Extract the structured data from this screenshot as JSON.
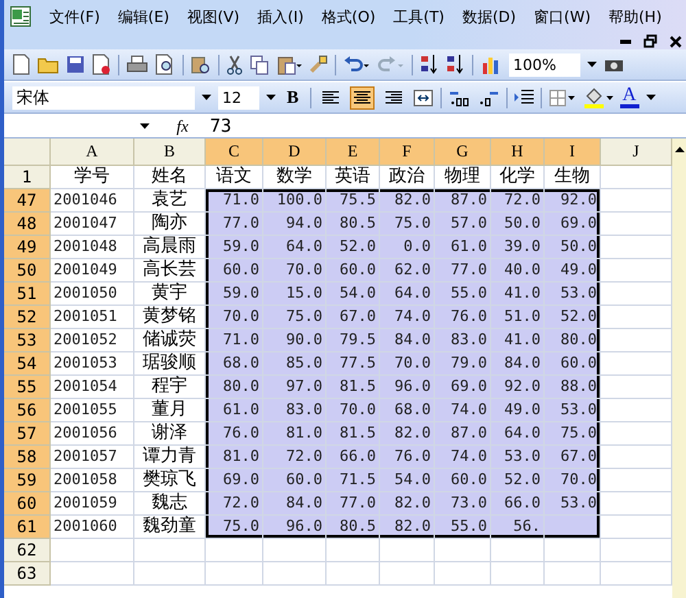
{
  "menu_bar": {
    "items": [
      "文件(F)",
      "编辑(E)",
      "视图(V)",
      "插入(I)",
      "格式(O)",
      "工具(T)",
      "数据(D)",
      "窗口(W)",
      "帮助(H)"
    ]
  },
  "standard_toolbar": {
    "zoom": "100%"
  },
  "formatting_toolbar": {
    "font": "宋体",
    "size": "12",
    "bold": "B",
    "font_color": "A",
    "alignment": [
      {
        "kind": "left",
        "selected": false
      },
      {
        "kind": "center",
        "selected": true
      },
      {
        "kind": "right",
        "selected": false
      }
    ]
  },
  "formula_bar": {
    "fx": "fx",
    "value": "73"
  },
  "sheet": {
    "columns": [
      {
        "label": "A",
        "selected": false
      },
      {
        "label": "B",
        "selected": false
      },
      {
        "label": "C",
        "selected": true
      },
      {
        "label": "D",
        "selected": true
      },
      {
        "label": "E",
        "selected": true
      },
      {
        "label": "F",
        "selected": true
      },
      {
        "label": "G",
        "selected": true
      },
      {
        "label": "H",
        "selected": true
      },
      {
        "label": "I",
        "selected": true
      },
      {
        "label": "J",
        "selected": false
      }
    ],
    "rows": [
      {
        "number": "1",
        "selected": false,
        "cells": [
          "学号",
          "姓名",
          "语文",
          "数学",
          "英语",
          "政治",
          "物理",
          "化学",
          "生物"
        ]
      },
      {
        "number": "47",
        "selected": true,
        "cells": [
          "2001046",
          "袁艺",
          "71.0",
          "100.0",
          "75.5",
          "82.0",
          "87.0",
          "72.0",
          "92.0"
        ]
      },
      {
        "number": "48",
        "selected": true,
        "cells": [
          "2001047",
          "陶亦",
          "77.0",
          "94.0",
          "80.5",
          "75.0",
          "57.0",
          "50.0",
          "69.0"
        ]
      },
      {
        "number": "49",
        "selected": true,
        "cells": [
          "2001048",
          "高晨雨",
          "59.0",
          "64.0",
          "52.0",
          "0.0",
          "61.0",
          "39.0",
          "50.0"
        ]
      },
      {
        "number": "50",
        "selected": true,
        "cells": [
          "2001049",
          "高长芸",
          "60.0",
          "70.0",
          "60.0",
          "62.0",
          "77.0",
          "40.0",
          "49.0"
        ]
      },
      {
        "number": "51",
        "selected": true,
        "cells": [
          "2001050",
          "黄宇",
          "59.0",
          "15.0",
          "54.0",
          "64.0",
          "55.0",
          "41.0",
          "53.0"
        ]
      },
      {
        "number": "52",
        "selected": true,
        "cells": [
          "2001051",
          "黄梦铭",
          "70.0",
          "75.0",
          "67.0",
          "74.0",
          "76.0",
          "51.0",
          "52.0"
        ]
      },
      {
        "number": "53",
        "selected": true,
        "cells": [
          "2001052",
          "储诚荧",
          "71.0",
          "90.0",
          "79.5",
          "84.0",
          "83.0",
          "41.0",
          "80.0"
        ]
      },
      {
        "number": "54",
        "selected": true,
        "cells": [
          "2001053",
          "琚骏顺",
          "68.0",
          "85.0",
          "77.5",
          "70.0",
          "79.0",
          "84.0",
          "60.0"
        ]
      },
      {
        "number": "55",
        "selected": true,
        "cells": [
          "2001054",
          "程宇",
          "80.0",
          "97.0",
          "81.5",
          "96.0",
          "69.0",
          "92.0",
          "88.0"
        ]
      },
      {
        "number": "56",
        "selected": true,
        "cells": [
          "2001055",
          "董月",
          "61.0",
          "83.0",
          "70.0",
          "68.0",
          "74.0",
          "49.0",
          "53.0"
        ]
      },
      {
        "number": "57",
        "selected": true,
        "cells": [
          "2001056",
          "谢泽",
          "76.0",
          "81.0",
          "81.5",
          "82.0",
          "87.0",
          "64.0",
          "75.0"
        ]
      },
      {
        "number": "58",
        "selected": true,
        "cells": [
          "2001057",
          "谭力青",
          "81.0",
          "72.0",
          "66.0",
          "76.0",
          "74.0",
          "53.0",
          "67.0"
        ]
      },
      {
        "number": "59",
        "selected": true,
        "cells": [
          "2001058",
          "樊琼飞",
          "69.0",
          "60.0",
          "71.5",
          "54.0",
          "60.0",
          "52.0",
          "70.0"
        ]
      },
      {
        "number": "60",
        "selected": true,
        "cells": [
          "2001059",
          "魏志",
          "72.0",
          "84.0",
          "77.0",
          "82.0",
          "73.0",
          "66.0",
          "53.0"
        ]
      },
      {
        "number": "61",
        "selected": true,
        "cells": [
          "2001060",
          "魏劲童",
          "75.0",
          "96.0",
          "80.5",
          "82.0",
          "55.0",
          "56."
        ]
      },
      {
        "number": "62",
        "selected": false
      },
      {
        "number": "63",
        "selected": false
      }
    ]
  }
}
